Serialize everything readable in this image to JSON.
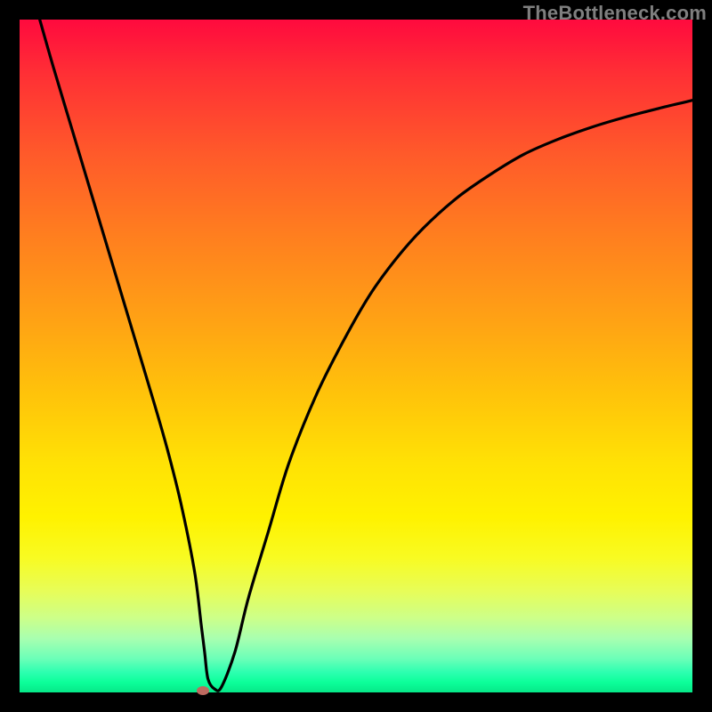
{
  "watermark": "TheBottleneck.com",
  "colors": {
    "curve": "#000000",
    "marker": "#bd6a60",
    "frame_bg": "#000000"
  },
  "chart_data": {
    "type": "line",
    "title": "",
    "xlabel": "",
    "ylabel": "",
    "xlim": [
      0,
      100
    ],
    "ylim": [
      0,
      100
    ],
    "grid": false,
    "legend": false,
    "series": [
      {
        "name": "bottleneck-curve",
        "x": [
          3,
          5,
          8,
          11,
          14,
          17,
          20,
          22,
          24,
          26,
          27,
          27.5,
          28,
          29,
          30,
          32,
          34,
          37,
          40,
          44,
          48,
          52,
          56,
          60,
          65,
          70,
          75,
          80,
          85,
          90,
          95,
          100
        ],
        "y": [
          100,
          93,
          83,
          73,
          63,
          53,
          43,
          36,
          28,
          18,
          10,
          6,
          2,
          0.5,
          0.8,
          6,
          14,
          24,
          34,
          44,
          52,
          59,
          64.5,
          69,
          73.5,
          77,
          80,
          82.2,
          84,
          85.5,
          86.8,
          88
        ]
      }
    ],
    "marker": {
      "x": 27.3,
      "y": 0.3
    }
  }
}
